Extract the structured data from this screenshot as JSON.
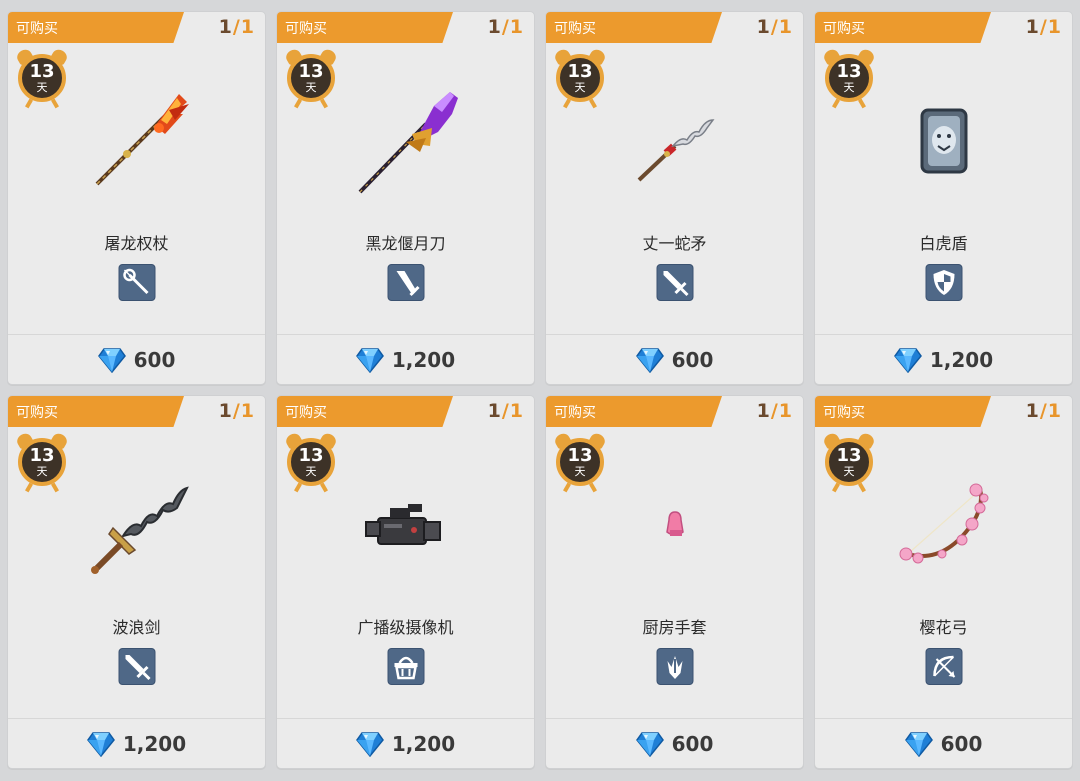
{
  "tag_label": "可购买",
  "timer_unit": "天",
  "colors": {
    "tag": "#ec9a2d",
    "count_current": "#6b4a2e",
    "count_max": "#e8952b",
    "type_icon_bg": "#4f6887",
    "gem": "#2a8fe0"
  },
  "items": [
    {
      "name": "屠龙权杖",
      "count_current": "1",
      "count_sep": "/",
      "count_max": "1",
      "timer": "13",
      "price": "600",
      "type_icon": "staff-icon",
      "art": "staff"
    },
    {
      "name": "黑龙偃月刀",
      "count_current": "1",
      "count_sep": "/",
      "count_max": "1",
      "timer": "13",
      "price": "1,200",
      "type_icon": "broadsword-icon",
      "art": "glaive"
    },
    {
      "name": "丈一蛇矛",
      "count_current": "1",
      "count_sep": "/",
      "count_max": "1",
      "timer": "13",
      "price": "600",
      "type_icon": "sword-icon",
      "art": "spear"
    },
    {
      "name": "白虎盾",
      "count_current": "1",
      "count_sep": "/",
      "count_max": "1",
      "timer": "13",
      "price": "1,200",
      "type_icon": "shield-icon",
      "art": "shield"
    },
    {
      "name": "波浪剑",
      "count_current": "1",
      "count_sep": "/",
      "count_max": "1",
      "timer": "13",
      "price": "1,200",
      "type_icon": "sword-icon",
      "art": "wave-sword"
    },
    {
      "name": "广播级摄像机",
      "count_current": "1",
      "count_sep": "/",
      "count_max": "1",
      "timer": "13",
      "price": "1,200",
      "type_icon": "basket-icon",
      "art": "camera"
    },
    {
      "name": "厨房手套",
      "count_current": "1",
      "count_sep": "/",
      "count_max": "1",
      "timer": "13",
      "price": "600",
      "type_icon": "glove-icon",
      "art": "glove"
    },
    {
      "name": "樱花弓",
      "count_current": "1",
      "count_sep": "/",
      "count_max": "1",
      "timer": "13",
      "price": "600",
      "type_icon": "bow-icon",
      "art": "bow"
    }
  ]
}
